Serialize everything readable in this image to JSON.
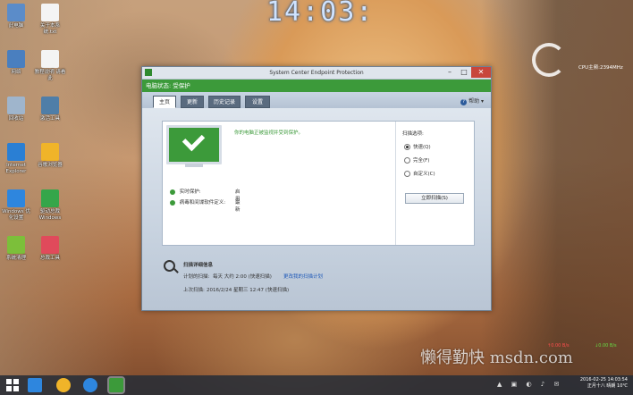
{
  "desktop": {
    "icons": [
      {
        "label": "此电脑",
        "icon": "computer-icon",
        "color": "#5b8cc9"
      },
      {
        "label": "关于本系统.txt",
        "icon": "text-file-icon",
        "color": "#f4f4f4"
      },
      {
        "label": "网络",
        "icon": "network-icon",
        "color": "#4a7fbf"
      },
      {
        "label": "教程说明\n请看此",
        "icon": "document-icon",
        "color": "#f4f4f4"
      },
      {
        "label": "回收站",
        "icon": "recycle-bin-icon",
        "color": "#9fb5cc"
      },
      {
        "label": "激活工具",
        "icon": "activation-tool-icon",
        "color": "#4f7ea8"
      },
      {
        "label": "Internet Explorer",
        "icon": "internet-explorer-icon",
        "color": "#2a7fd4"
      },
      {
        "label": "谷歌浏览器",
        "icon": "chrome-icon",
        "color": "#f0b429"
      },
      {
        "label": "Windows 优化设置",
        "icon": "settings-gears-icon",
        "color": "#2e86de"
      },
      {
        "label": "驱动总裁 Windows",
        "icon": "driver-icon",
        "color": "#35a64a"
      },
      {
        "label": "系统清理",
        "icon": "cleaner-icon",
        "color": "#7cbf3a"
      },
      {
        "label": "总裁工具",
        "icon": "toolbox-icon",
        "color": "#e04a5b"
      }
    ]
  },
  "clock": {
    "time": "14:03:"
  },
  "cpu": {
    "label": "CPU主频:2394MHz"
  },
  "window": {
    "title": "System Center Endpoint Protection",
    "status": "电脑状态: 受保护",
    "tabs": [
      {
        "label": "主页"
      },
      {
        "label": "更新"
      },
      {
        "label": "历史记录"
      },
      {
        "label": "设置"
      }
    ],
    "help": "帮助",
    "main": {
      "message": "你的电脑正被监视并受到保护。",
      "statuses": [
        {
          "label": "实时保护:",
          "value": "启用"
        },
        {
          "label": "病毒和间谍软件定义:",
          "value": "最新"
        }
      ]
    },
    "scan": {
      "title": "扫描选项:",
      "options": [
        {
          "label": "快速(Q)",
          "checked": true
        },
        {
          "label": "完全(F)",
          "checked": false
        },
        {
          "label": "自定义(C)",
          "checked": false
        }
      ],
      "button": "立即扫描(S)"
    },
    "details": {
      "title": "扫描详细信息",
      "scheduled_label": "计划的扫描:",
      "scheduled_value": "每天 大约 2:00 (快速扫描)",
      "change_link": "更改我的扫描计划",
      "last_label": "上次扫描:",
      "last_value": "2016/2/24 星期三 12:47 (快速扫描)"
    }
  },
  "taskbar": {
    "date": "2016-02-25",
    "time": "14:03:54",
    "lunar": "正月十八 晴朗 10℃"
  },
  "watermark": "懒得勤快 msdn.com",
  "netspeed": {
    "up": "↑0.00 B/s",
    "down": "↓0.00 B/s"
  }
}
